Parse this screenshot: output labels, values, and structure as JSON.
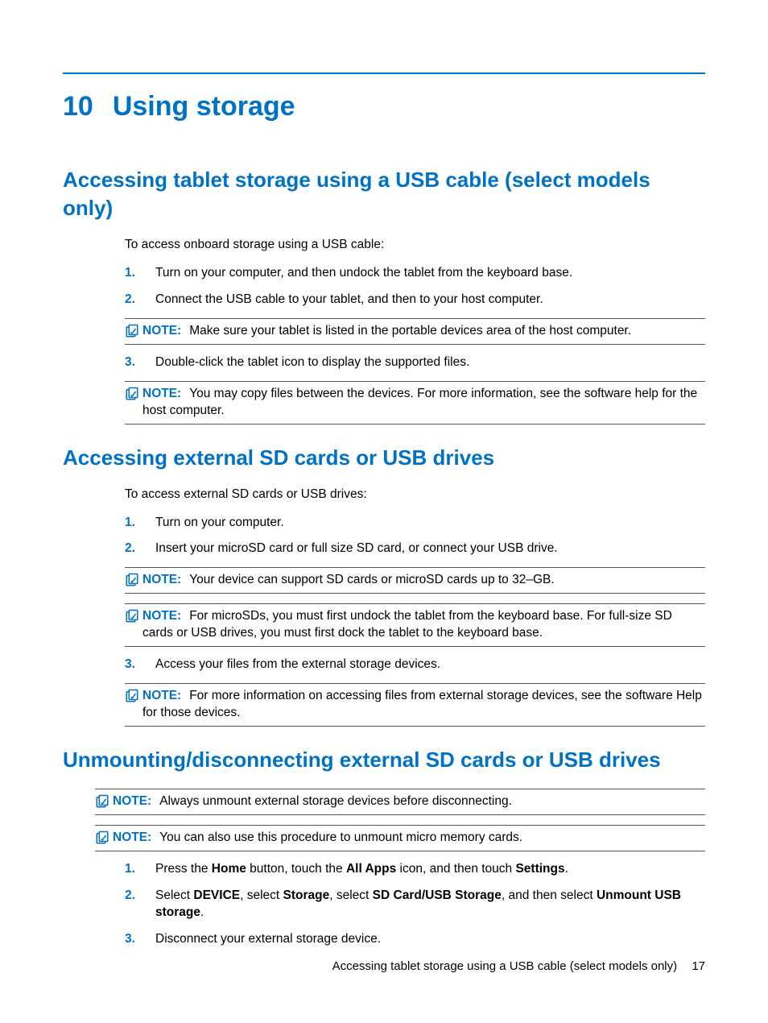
{
  "chapter": {
    "number": "10",
    "title": "Using storage"
  },
  "sections": {
    "s1": {
      "heading": "Accessing tablet storage using a USB cable (select models only)",
      "intro": "To access onboard storage using a USB cable:",
      "step1": "Turn on your computer, and then undock the tablet from the keyboard base.",
      "step2": "Connect the USB cable to your tablet, and then to your host computer.",
      "note1": "Make sure your tablet is listed in the portable devices area of the host computer.",
      "step3": "Double-click the tablet icon to display the supported files.",
      "note2": "You may copy files between the devices. For more information, see the software help for the host computer."
    },
    "s2": {
      "heading": "Accessing external SD cards or USB drives",
      "intro": "To access external SD cards or USB drives:",
      "step1": "Turn on your computer.",
      "step2": "Insert your microSD card or full size SD card, or connect your USB drive.",
      "note1": "Your device can support SD cards or microSD cards up to 32–GB.",
      "note2": "For microSDs, you must first undock the tablet from the keyboard base. For full-size SD cards or USB drives, you must first dock the tablet to the keyboard base.",
      "step3": "Access your files from the external storage devices.",
      "note3": "For more information on accessing files from external storage devices, see the software Help for those devices."
    },
    "s3": {
      "heading": "Unmounting/disconnecting external SD cards or USB drives",
      "note1": "Always unmount external storage devices before disconnecting.",
      "note2": "You can also use this procedure to unmount micro memory cards.",
      "step1_parts": {
        "a": "Press the ",
        "b": "Home",
        "c": " button, touch the ",
        "d": "All Apps",
        "e": " icon, and then touch ",
        "f": "Settings",
        "g": "."
      },
      "step2_parts": {
        "a": "Select ",
        "b": "DEVICE",
        "c": ", select ",
        "d": "Storage",
        "e": ", select ",
        "f": "SD Card/USB Storage",
        "g": ", and then select ",
        "h": "Unmount USB storage",
        "i": "."
      },
      "step3": "Disconnect your external storage device."
    }
  },
  "labels": {
    "note": "NOTE:",
    "n1": "1.",
    "n2": "2.",
    "n3": "3."
  },
  "footer": {
    "text": "Accessing tablet storage using a USB cable (select models only)",
    "page": "17"
  }
}
